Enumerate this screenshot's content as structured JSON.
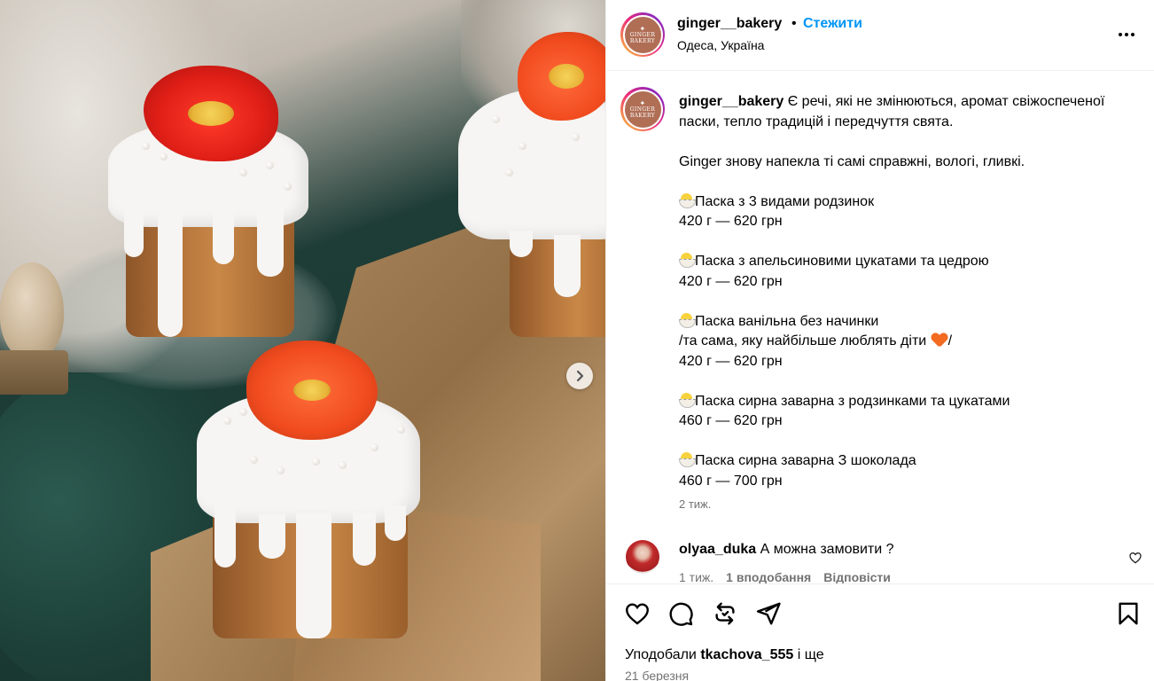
{
  "post": {
    "username": "ginger__bakery",
    "follow_label": "Стежити",
    "location": "Одеса, Україна",
    "avatar_logo_line1": "GINGER",
    "avatar_logo_line2": "BAKERY"
  },
  "caption": {
    "username": "ginger__bakery",
    "intro": "Є речі, які не змінюються, аромат свіжоспеченої паски, тепло традицій і передчуття свята.",
    "line2": "Ginger знову напекла ті самі справжні, вологі, гливкі.",
    "items": [
      {
        "name": "Паска з 3 видами родзинок",
        "price": "420 г — 620 грн"
      },
      {
        "name": "Паска з апельсиновими цукатами та цедрою",
        "price": "420 г — 620 грн"
      },
      {
        "name": "Паска ванільна без начинки",
        "note_before": "/та сама, яку найбільше люблять діти ",
        "note_after": "/",
        "price": "420 г — 620 грн"
      },
      {
        "name": "Паска сирна заварна з родзинками та цукатами",
        "price": "460 г — 620 грн"
      },
      {
        "name": "Паска сирна заварна З шоколада",
        "price": "460 г — 700 грн"
      }
    ],
    "time": "2 тиж."
  },
  "comment": {
    "username": "olyaa_duka",
    "text": "А можна замовити ?",
    "time": "1 тиж.",
    "likes": "1 вподобання",
    "reply_label": "Відповісти"
  },
  "engagement": {
    "liked_prefix": "Уподобали",
    "liked_user": "tkachova_555",
    "liked_suffix": "і ще",
    "date": "21 березня"
  },
  "icons": {
    "next": "chevron-right-icon",
    "more": "more-horizontal-icon",
    "like": "heart-icon",
    "comment": "comment-icon",
    "repost": "repost-icon",
    "share": "send-icon",
    "save": "bookmark-icon"
  },
  "colors": {
    "follow": "#0095f6",
    "muted": "#737373",
    "border": "#efefef"
  }
}
